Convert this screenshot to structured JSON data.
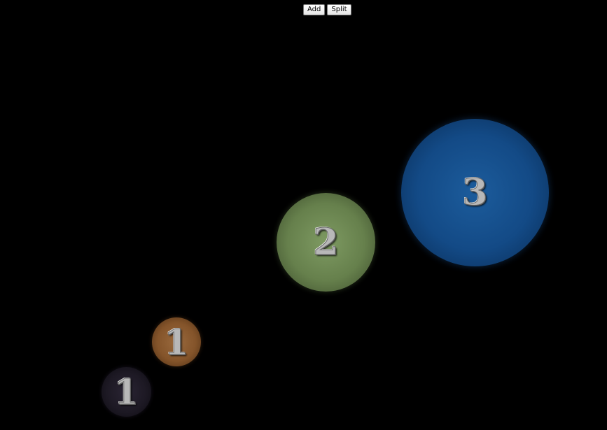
{
  "toolbar": {
    "add_label": "Add",
    "split_label": "Split"
  },
  "balls": [
    {
      "label": "1",
      "color": "#1d1924"
    },
    {
      "label": "1",
      "color": "#84542a"
    },
    {
      "label": "2",
      "color": "#66804c"
    },
    {
      "label": "3",
      "color": "#134a86"
    }
  ],
  "colors": {
    "background": "#000000"
  }
}
